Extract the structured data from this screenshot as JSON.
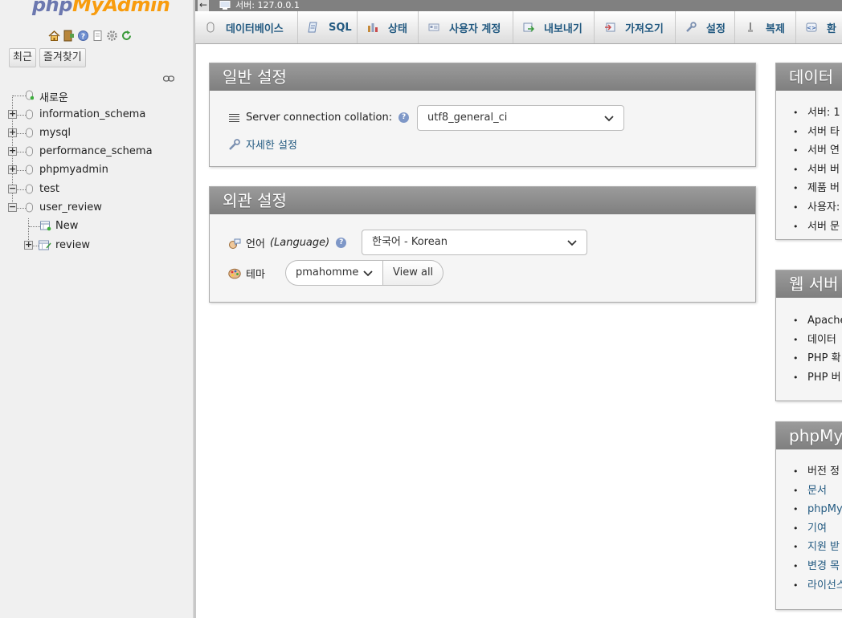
{
  "app": {
    "logo_php": "php",
    "logo_myadmin": "MyAdmin"
  },
  "nav": {
    "icons": [
      "home-icon",
      "exit-icon",
      "help-icon",
      "docs-icon",
      "settings-icon",
      "reload-icon"
    ],
    "tabs": [
      "최근",
      "즐겨찾기"
    ],
    "tree": [
      {
        "label": "새로운",
        "type": "new"
      },
      {
        "label": "information_schema",
        "type": "db",
        "expander": "+"
      },
      {
        "label": "mysql",
        "type": "db",
        "expander": "+"
      },
      {
        "label": "performance_schema",
        "type": "db",
        "expander": "+"
      },
      {
        "label": "phpmyadmin",
        "type": "db",
        "expander": "+"
      },
      {
        "label": "test",
        "type": "db",
        "expander": "−"
      },
      {
        "label": "user_review",
        "type": "db",
        "expander": "−"
      },
      {
        "label": "New",
        "type": "new-table"
      },
      {
        "label": "review",
        "type": "table",
        "expander": "+"
      }
    ]
  },
  "topbar": {
    "back": "←",
    "server_label": "서버: 127.0.0.1"
  },
  "menubar": [
    {
      "label": "데이터베이스",
      "icon": "database-icon"
    },
    {
      "label": "SQL",
      "icon": "sql-icon"
    },
    {
      "label": "상태",
      "icon": "status-icon"
    },
    {
      "label": "사용자 계정",
      "icon": "user-accounts-icon"
    },
    {
      "label": "내보내기",
      "icon": "export-icon"
    },
    {
      "label": "가져오기",
      "icon": "import-icon"
    },
    {
      "label": "설정",
      "icon": "settings-icon"
    },
    {
      "label": "복제",
      "icon": "replication-icon"
    },
    {
      "label": "환",
      "icon": "variables-icon"
    }
  ],
  "general_settings": {
    "title": "일반 설정",
    "collation_label": "Server connection collation:",
    "collation_value": "utf8_general_ci",
    "more_settings": "자세한 설정"
  },
  "appearance_settings": {
    "title": "외관 설정",
    "language_label": "언어",
    "language_label_en": "(Language)",
    "language_value": "한국어 - Korean",
    "theme_label": "테마",
    "theme_value": "pmahomme",
    "view_all": "View all"
  },
  "right_panels": {
    "db_server": {
      "title": "데이터",
      "items": [
        "서버: 1",
        "서버 타",
        "서버 연",
        "서버 버",
        "제품 버",
        "사용자:",
        "서버 문"
      ]
    },
    "web_server": {
      "title": "웹 서버",
      "items": [
        "Apache",
        "데이터",
        "PHP 확",
        "PHP 버"
      ]
    },
    "phpmyadmin": {
      "title": "phpMy",
      "items": [
        "버전 정",
        "문서",
        "phpMy",
        "기여",
        "지원 받",
        "변경 목",
        "라이선스"
      ]
    }
  }
}
